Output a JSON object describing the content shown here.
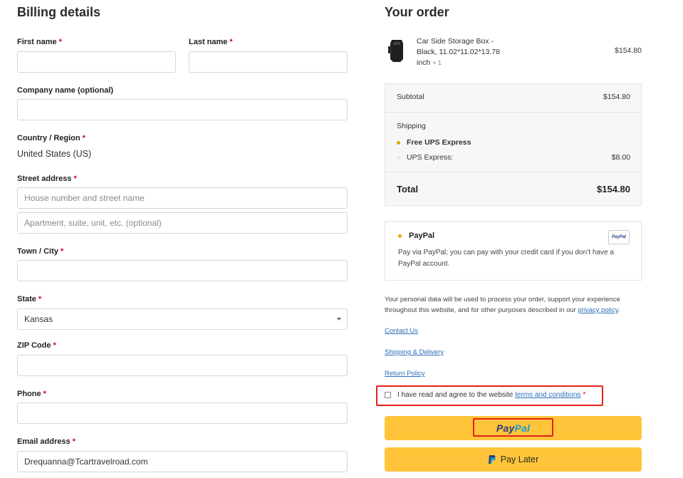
{
  "billing": {
    "title": "Billing details",
    "first_name": {
      "label": "First name",
      "req": "*",
      "value": ""
    },
    "last_name": {
      "label": "Last name",
      "req": "*",
      "value": ""
    },
    "company": {
      "label": "Company name (optional)",
      "value": ""
    },
    "country": {
      "label": "Country / Region",
      "req": "*",
      "value": "United States (US)"
    },
    "street": {
      "label": "Street address",
      "req": "*",
      "placeholder1": "House number and street name",
      "placeholder2": "Apartment, suite, unit, etc. (optional)"
    },
    "city": {
      "label": "Town / City",
      "req": "*",
      "value": ""
    },
    "state": {
      "label": "State",
      "req": "*",
      "value": "Kansas"
    },
    "zip": {
      "label": "ZIP Code",
      "req": "*",
      "value": ""
    },
    "phone": {
      "label": "Phone",
      "req": "*",
      "value": ""
    },
    "email": {
      "label": "Email address",
      "req": "*",
      "value": "Drequanna@Tcartravelroad.com"
    }
  },
  "order": {
    "title": "Your order",
    "product": {
      "name_line1": "Car Side Storage Box -",
      "name_line2": "Black, 11.02*11.02*13.78",
      "name_line3": "inch",
      "qty": "× 1",
      "price": "$154.80"
    },
    "subtotal_label": "Subtotal",
    "subtotal_value": "$154.80",
    "shipping_label": "Shipping",
    "shipping_options": [
      {
        "label": "Free UPS Express",
        "price": "",
        "selected": true
      },
      {
        "label": "UPS Express:",
        "price": "$8.00",
        "selected": false
      }
    ],
    "total_label": "Total",
    "total_value": "$154.80"
  },
  "payment": {
    "method_label": "PayPal",
    "badge_text": "PayPal",
    "description_line1": "Pay via PayPal; you can pay with your credit card if you don’t have a",
    "description_line2": "PayPal account."
  },
  "privacy": {
    "line1": "Your personal data will be used to process your order, support your experience",
    "line2_prefix": "throughout this website, and for other purposes described in our ",
    "link": "privacy policy",
    "line2_suffix": "."
  },
  "links": {
    "contact": "Contact Us",
    "shipping": "Shipping & Delivery",
    "return": "Return Policy"
  },
  "terms": {
    "prefix": "I have read and agree to the website ",
    "link": "terms and conditions",
    "req": "*"
  },
  "buttons": {
    "paypal_pay": "Pay",
    "paypal_pal": "Pal",
    "pay_later": "Pay Later"
  },
  "colors": {
    "accent_yellow": "#ffc439",
    "paypal_dark": "#253b80",
    "paypal_light": "#179bd7",
    "required_red": "#d0021b",
    "highlight_red": "#e2231a",
    "link_blue": "#2a6ebb"
  }
}
